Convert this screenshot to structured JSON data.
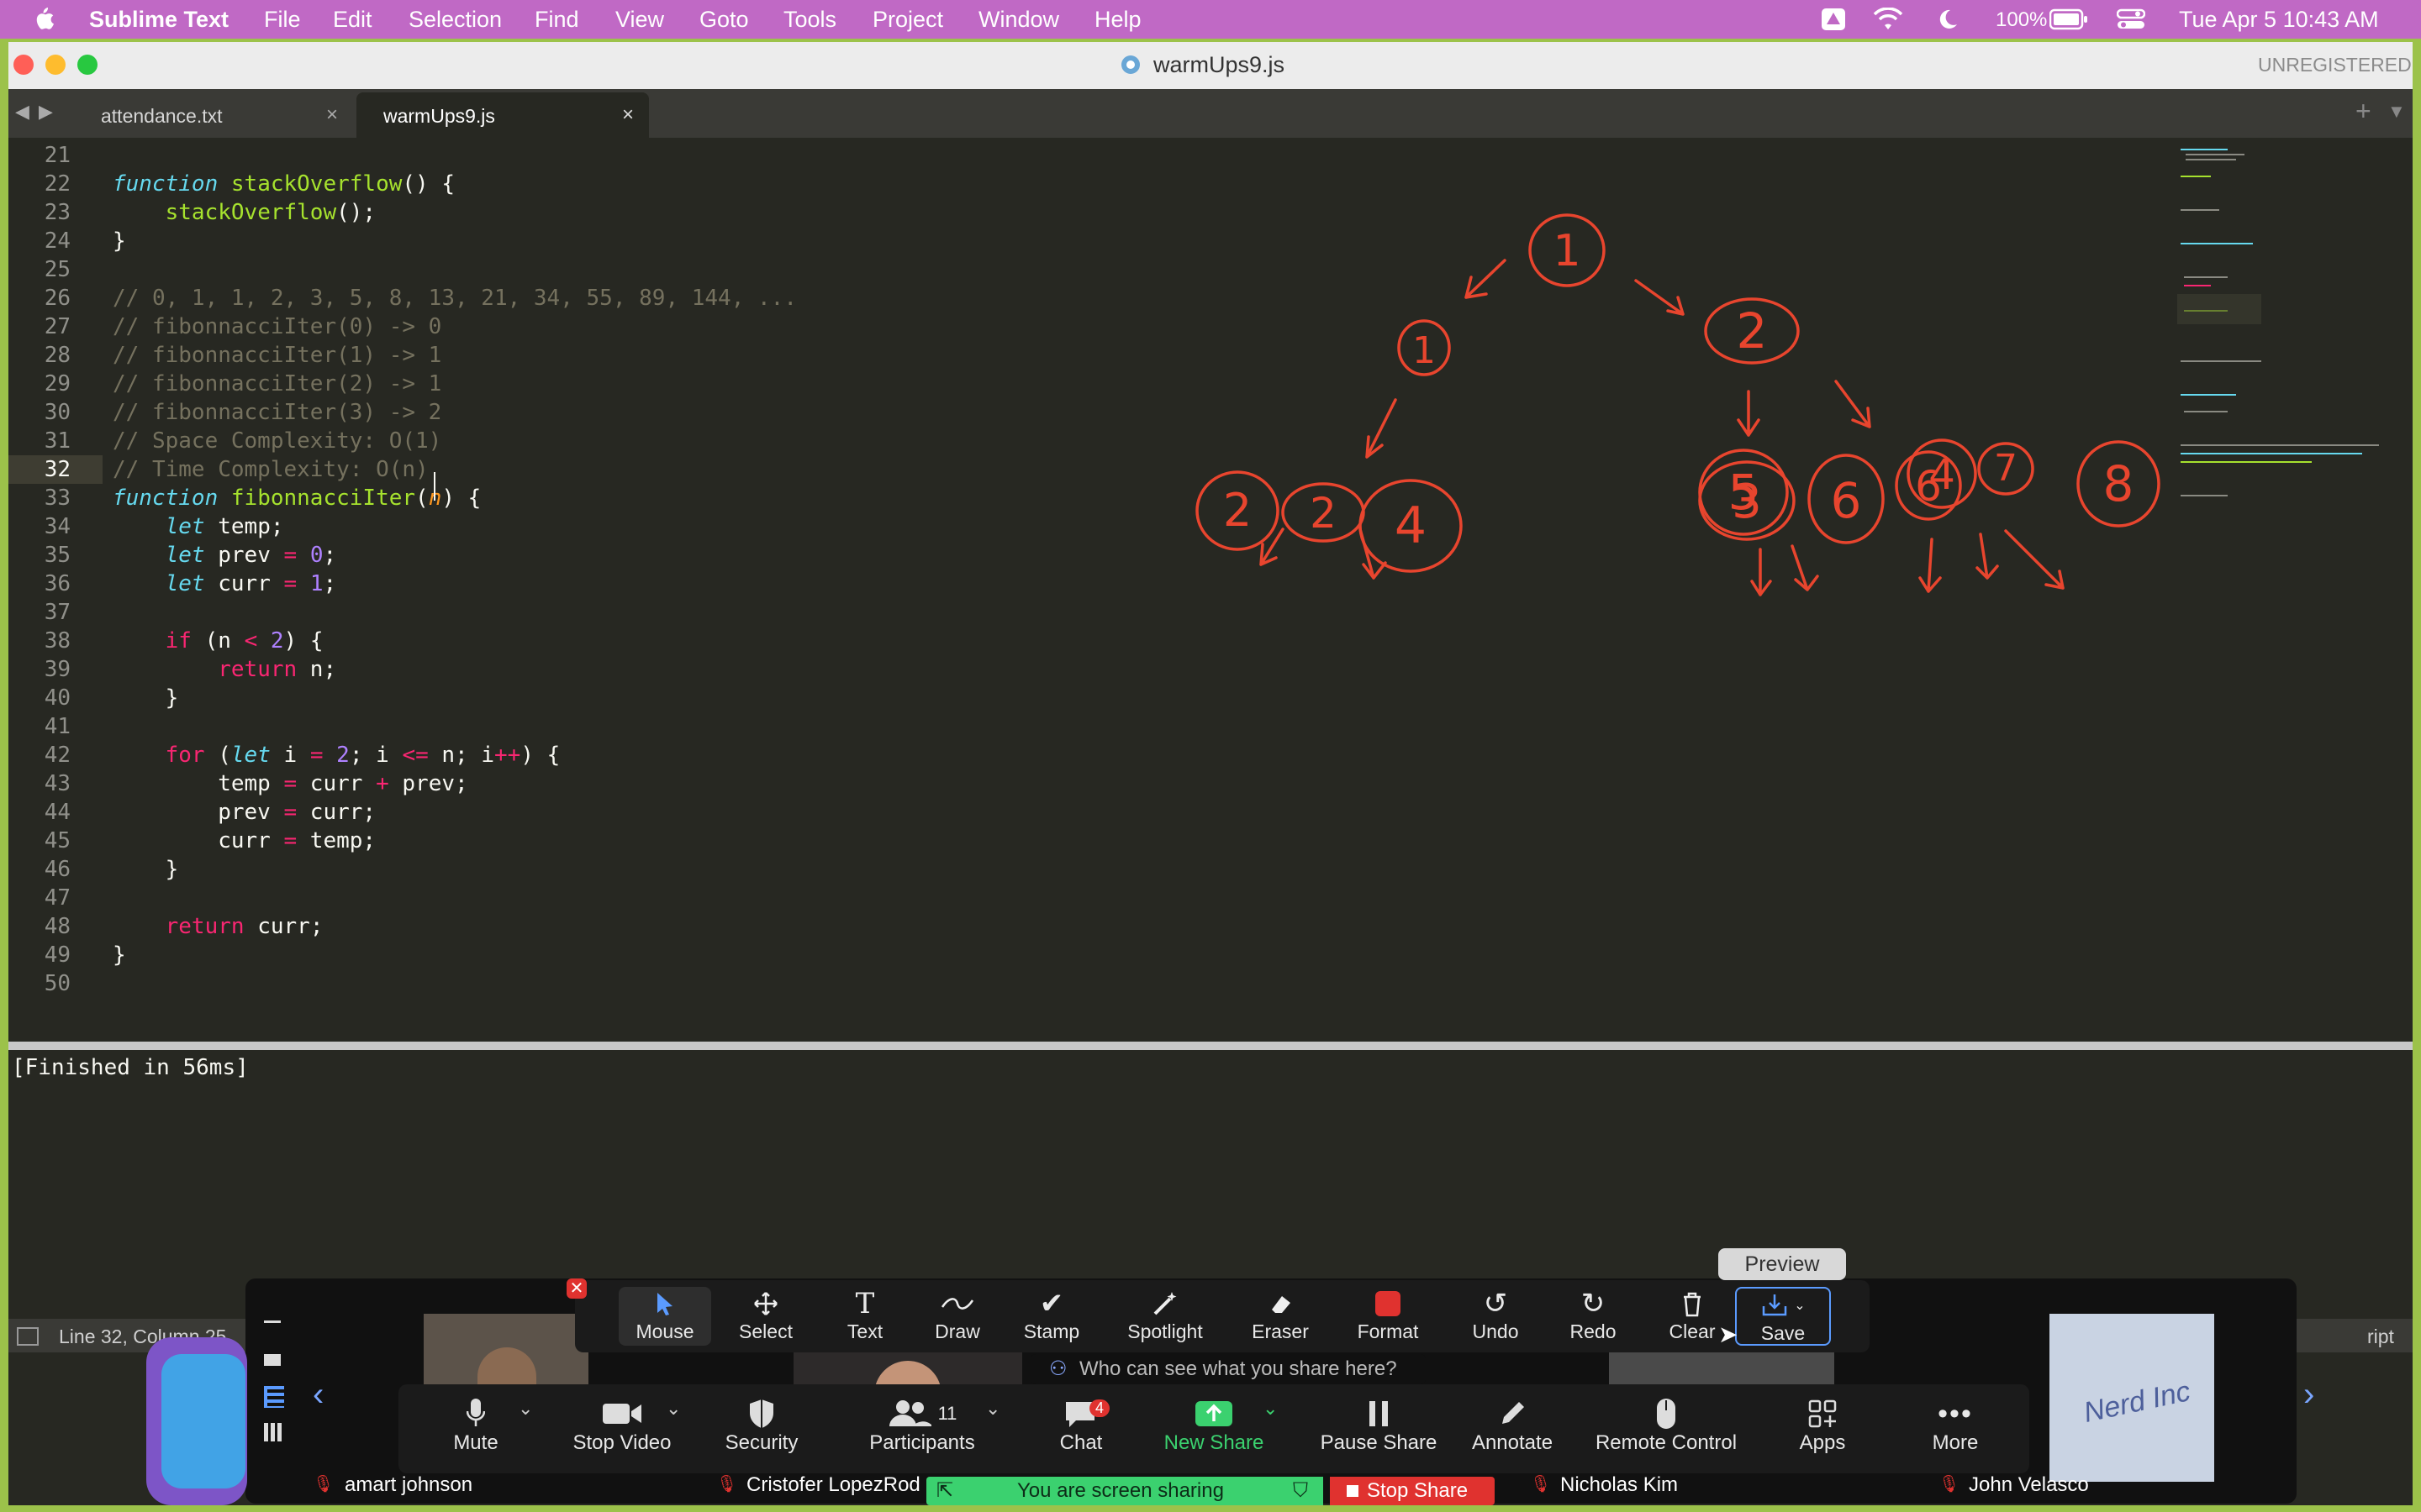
{
  "menubar": {
    "app_name": "Sublime Text",
    "menus": [
      "File",
      "Edit",
      "Selection",
      "Find",
      "View",
      "Goto",
      "Tools",
      "Project",
      "Window",
      "Help"
    ],
    "battery": "100%",
    "clock": "Tue Apr 5  10:43 AM"
  },
  "window": {
    "title": "warmUps9.js",
    "license": "UNREGISTERED"
  },
  "tabs": [
    {
      "label": "attendance.txt",
      "active": false
    },
    {
      "label": "warmUps9.js",
      "active": true
    }
  ],
  "editor": {
    "current_line": 32,
    "lines": [
      {
        "n": "21",
        "text": ""
      },
      {
        "n": "22",
        "text": "function stackOverflow() {"
      },
      {
        "n": "23",
        "text": "    stackOverflow();"
      },
      {
        "n": "24",
        "text": "}"
      },
      {
        "n": "25",
        "text": ""
      },
      {
        "n": "26",
        "text": "// 0, 1, 1, 2, 3, 5, 8, 13, 21, 34, 55, 89, 144, ..."
      },
      {
        "n": "27",
        "text": "// fibonnacciIter(0) -> 0"
      },
      {
        "n": "28",
        "text": "// fibonnacciIter(1) -> 1"
      },
      {
        "n": "29",
        "text": "// fibonnacciIter(2) -> 1"
      },
      {
        "n": "30",
        "text": "// fibonnacciIter(3) -> 2"
      },
      {
        "n": "31",
        "text": "// Space Complexity: O(1)"
      },
      {
        "n": "32",
        "text": "// Time Complexity: O(n)"
      },
      {
        "n": "33",
        "text": "function fibonnacciIter(n) {"
      },
      {
        "n": "34",
        "text": "    let temp;"
      },
      {
        "n": "35",
        "text": "    let prev = 0;"
      },
      {
        "n": "36",
        "text": "    let curr = 1;"
      },
      {
        "n": "37",
        "text": ""
      },
      {
        "n": "38",
        "text": "    if (n < 2) {"
      },
      {
        "n": "39",
        "text": "        return n;"
      },
      {
        "n": "40",
        "text": "    }"
      },
      {
        "n": "41",
        "text": ""
      },
      {
        "n": "42",
        "text": "    for (let i = 2; i <= n; i++) {"
      },
      {
        "n": "43",
        "text": "        temp = curr + prev;"
      },
      {
        "n": "44",
        "text": "        prev = curr;"
      },
      {
        "n": "45",
        "text": "        curr = temp;"
      },
      {
        "n": "46",
        "text": "    }"
      },
      {
        "n": "47",
        "text": ""
      },
      {
        "n": "48",
        "text": "    return curr;"
      },
      {
        "n": "49",
        "text": "}"
      },
      {
        "n": "50",
        "text": ""
      }
    ]
  },
  "drawing_numbers": [
    "1",
    "1",
    "2",
    "2",
    "3",
    "4",
    "3",
    "4",
    "5",
    "6",
    "6",
    "7",
    "8"
  ],
  "output": {
    "text": "[Finished in 56ms]"
  },
  "statusbar": {
    "position": "Line 32, Column 25",
    "syntax": "ript"
  },
  "zoom": {
    "annotate_tools": [
      "Mouse",
      "Select",
      "Text",
      "Draw",
      "Stamp",
      "Spotlight",
      "Eraser",
      "Format",
      "Undo",
      "Redo",
      "Clear",
      "Save"
    ],
    "preview_tooltip": "Preview",
    "privacy_prompt": "Who can see what you share here?",
    "controls": [
      "Mute",
      "Stop Video",
      "Security",
      "Participants",
      "Chat",
      "New Share",
      "Pause Share",
      "Annotate",
      "Remote Control",
      "Apps",
      "More"
    ],
    "participants_count": "11",
    "chat_badge": "4",
    "sharing_text": "You are screen sharing",
    "stop_share": "Stop Share",
    "participant_names": [
      "amart johnson",
      "Cristofer LopezRod",
      "Nicholas Kim",
      "John Velasco"
    ],
    "tile_text": "Nerd Inc",
    "colors": {
      "accent_green": "#3bd16f",
      "stop_red": "#e0322f",
      "ink_red": "#e8452e"
    }
  }
}
